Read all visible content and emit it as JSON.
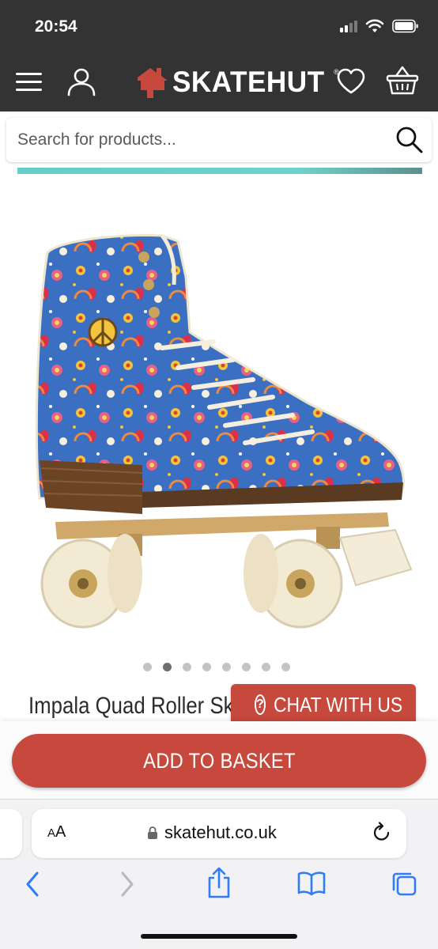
{
  "status_bar": {
    "time": "20:54",
    "icons": [
      "signal-icon",
      "wifi-icon",
      "battery-icon"
    ]
  },
  "header": {
    "brand": "SKATEHUT",
    "brand_mark": "®",
    "icons": [
      "menu-icon",
      "account-icon",
      "heart-icon",
      "basket-icon"
    ],
    "background": "#333333"
  },
  "search": {
    "placeholder": "Search for products..."
  },
  "product": {
    "image_alt": "Impala Quad Roller Skates",
    "title": "Impala Quad Roller Ska",
    "carousel": {
      "count": 8,
      "active_index": 1
    }
  },
  "chat": {
    "icon_glyph": "?",
    "label": "CHAT WITH US"
  },
  "actions": {
    "add_to_basket": "ADD TO BASKET",
    "accent": "#c7483d"
  },
  "browser": {
    "aa_big": "A",
    "aa_small": "A",
    "url": "skatehut.co.uk",
    "toolbar_icons": [
      "back-icon",
      "forward-icon",
      "share-icon",
      "bookmarks-icon",
      "tabs-icon"
    ]
  }
}
